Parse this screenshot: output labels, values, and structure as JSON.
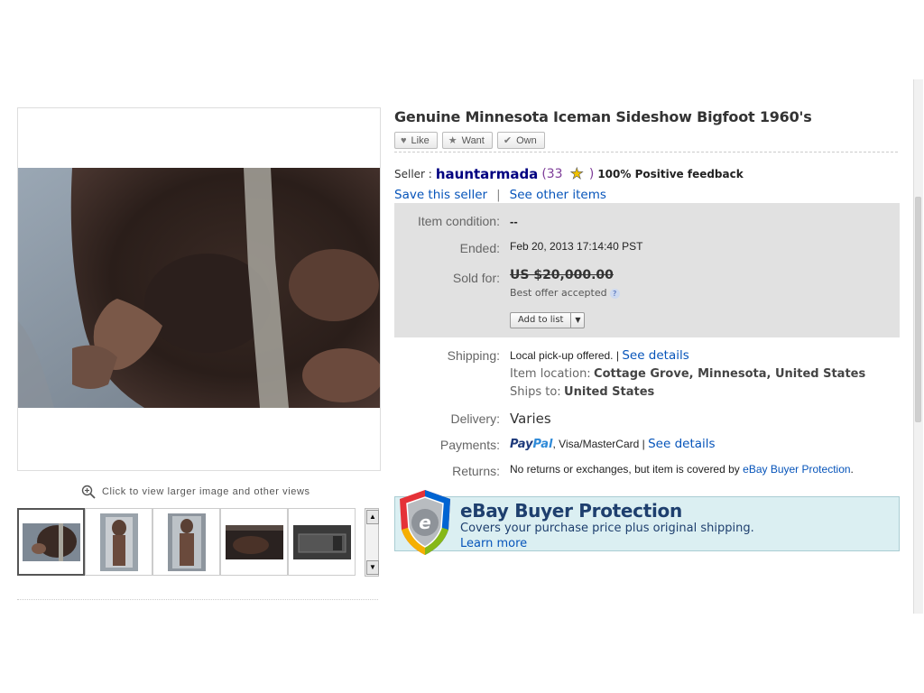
{
  "listing": {
    "title": "Genuine Minnesota Iceman Sideshow Bigfoot 1960's"
  },
  "social": {
    "like": "Like",
    "want": "Want",
    "own": "Own"
  },
  "seller": {
    "label": "Seller :",
    "name": "hauntarmada",
    "score_open": "(33",
    "score_close": ")",
    "positive_feedback": "100% Positive feedback",
    "save_link": "Save this seller",
    "separator": "|",
    "other_items_link": "See other items"
  },
  "details": {
    "condition_label": "Item condition:",
    "condition_value": "--",
    "ended_label": "Ended:",
    "ended_value": "Feb 20, 2013  17:14:40 PST",
    "sold_label": "Sold for:",
    "sold_value": "US $20,000.00",
    "best_offer": "Best offer accepted",
    "add_to_list": "Add to list"
  },
  "shipping": {
    "label": "Shipping:",
    "value": "Local pick-up offered. |",
    "see_details": "See details",
    "location_label": "Item location:",
    "location_value": "Cottage Grove, Minnesota, United States",
    "ships_to_label": "Ships to:",
    "ships_to_value": "United States"
  },
  "delivery": {
    "label": "Delivery:",
    "value": "Varies"
  },
  "payments": {
    "label": "Payments:",
    "paypal_part1": "Pay",
    "paypal_part2": "Pal",
    "methods": ", Visa/MasterCard |",
    "see_details": "See details"
  },
  "returns": {
    "label": "Returns:",
    "value": "No returns or exchanges, but item is covered by",
    "link": "eBay Buyer Protection",
    "period": "."
  },
  "buyer_protection": {
    "title": "eBay Buyer Protection",
    "subtitle": "Covers your purchase price plus original shipping.",
    "learn_more": "Learn more"
  },
  "gallery": {
    "zoom_hint": "Click to view larger image and other views",
    "thumbnails": [
      "thumb-1",
      "thumb-2",
      "thumb-3",
      "thumb-4",
      "thumb-5"
    ],
    "selected_index": 0
  },
  "colors": {
    "link": "#0654ba",
    "seller_name": "#000080",
    "details_bg": "#e1e1e1",
    "banner_bg": "#dbeff2"
  }
}
